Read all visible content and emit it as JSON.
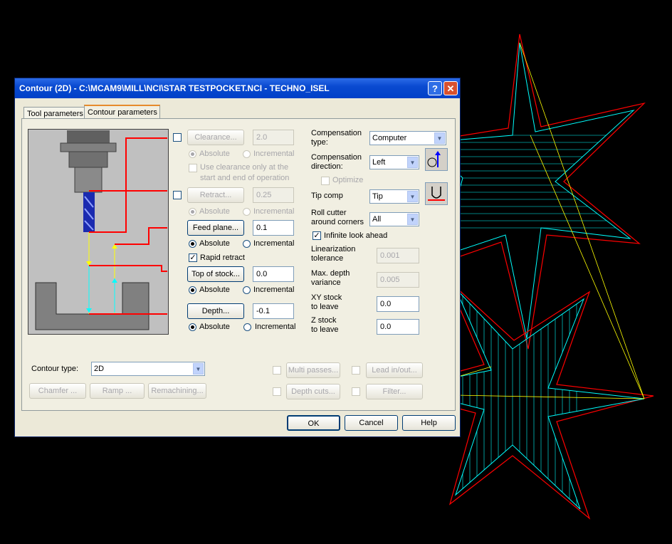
{
  "window": {
    "title": "Contour (2D) - C:\\MCAM9\\MILL\\NCI\\STAR TESTPOCKET.NCI - TECHNO_ISEL"
  },
  "tabs": [
    {
      "label": "Tool parameters",
      "active": false
    },
    {
      "label": "Contour parameters",
      "active": true
    }
  ],
  "clearance": {
    "button": "Clearance...",
    "value": "2.0",
    "checked": false
  },
  "retract": {
    "button": "Retract...",
    "value": "0.25",
    "checked": false
  },
  "feed_plane": {
    "button": "Feed plane...",
    "value": "0.1"
  },
  "top_of_stock": {
    "button": "Top of stock...",
    "value": "0.0"
  },
  "depth": {
    "button": "Depth...",
    "value": "-0.1"
  },
  "radio": {
    "absolute": "Absolute",
    "incremental": "Incremental"
  },
  "use_clearance": {
    "label_line1": "Use clearance only at the",
    "label_line2": "start and end of operation"
  },
  "rapid_retract": {
    "label": "Rapid retract",
    "checked": true
  },
  "compensation_type": {
    "label_line1": "Compensation",
    "label_line2": "type:",
    "value": "Computer"
  },
  "compensation_direction": {
    "label_line1": "Compensation",
    "label_line2": "direction:",
    "value": "Left"
  },
  "optimize": {
    "label": "Optimize"
  },
  "tip_comp": {
    "label": "Tip comp",
    "value": "Tip"
  },
  "roll_cutter": {
    "label_line1": "Roll cutter",
    "label_line2": "around corners",
    "value": "All"
  },
  "infinite_look_ahead": {
    "label": "Infinite look ahead",
    "checked": true
  },
  "linearization": {
    "label_line1": "Linearization",
    "label_line2": "tolerance",
    "value": "0.001"
  },
  "max_depth": {
    "label_line1": "Max. depth",
    "label_line2": "variance",
    "value": "0.005"
  },
  "xy_stock": {
    "label_line1": "XY stock",
    "label_line2": "to leave",
    "value": "0.0"
  },
  "z_stock": {
    "label_line1": "Z stock",
    "label_line2": "to leave",
    "value": "0.0"
  },
  "contour_type": {
    "label": "Contour type:",
    "value": "2D"
  },
  "buttons": {
    "chamfer": "Chamfer ...",
    "ramp": "Ramp ...",
    "remachining": "Remachining...",
    "multi_passes": "Multi passes...",
    "depth_cuts": "Depth cuts...",
    "lead_in_out": "Lead in/out...",
    "filter": "Filter...",
    "ok": "OK",
    "cancel": "Cancel",
    "help": "Help"
  },
  "colors": {
    "title_blue": "#0a4ad0",
    "dialog_bg": "#ece9d8",
    "toolpath_cyan": "#00ffff",
    "boundary_red": "#ff0000",
    "rapid_yellow": "#ffff00"
  },
  "icons": {
    "help": "question-icon",
    "close": "close-icon",
    "direction": "comp-direction-icon",
    "tip": "tip-comp-icon"
  }
}
